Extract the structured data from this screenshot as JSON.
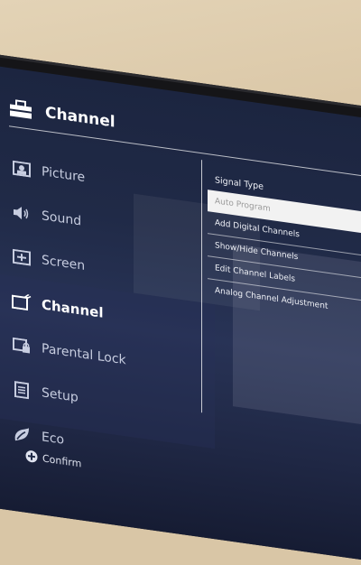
{
  "header": {
    "title": "Channel",
    "icon": "toolbox-icon"
  },
  "menu": {
    "items": [
      {
        "label": "Picture",
        "icon": "picture-icon"
      },
      {
        "label": "Sound",
        "icon": "speaker-icon"
      },
      {
        "label": "Screen",
        "icon": "screen-icon"
      },
      {
        "label": "Channel",
        "icon": "channel-icon",
        "active": true
      },
      {
        "label": "Parental Lock",
        "icon": "parental-lock-icon"
      },
      {
        "label": "Setup",
        "icon": "setup-icon"
      },
      {
        "label": "Eco",
        "icon": "eco-icon"
      }
    ]
  },
  "submenu": {
    "items": [
      {
        "label": "Signal Type"
      },
      {
        "label": "Auto Program",
        "selected": true
      },
      {
        "label": "Add Digital Channels"
      },
      {
        "label": "Show/Hide Channels"
      },
      {
        "label": "Edit Channel Labels"
      },
      {
        "label": "Analog Channel Adjustment"
      }
    ]
  },
  "footer": {
    "confirm_label": "Confirm",
    "icon": "confirm-button-icon"
  }
}
